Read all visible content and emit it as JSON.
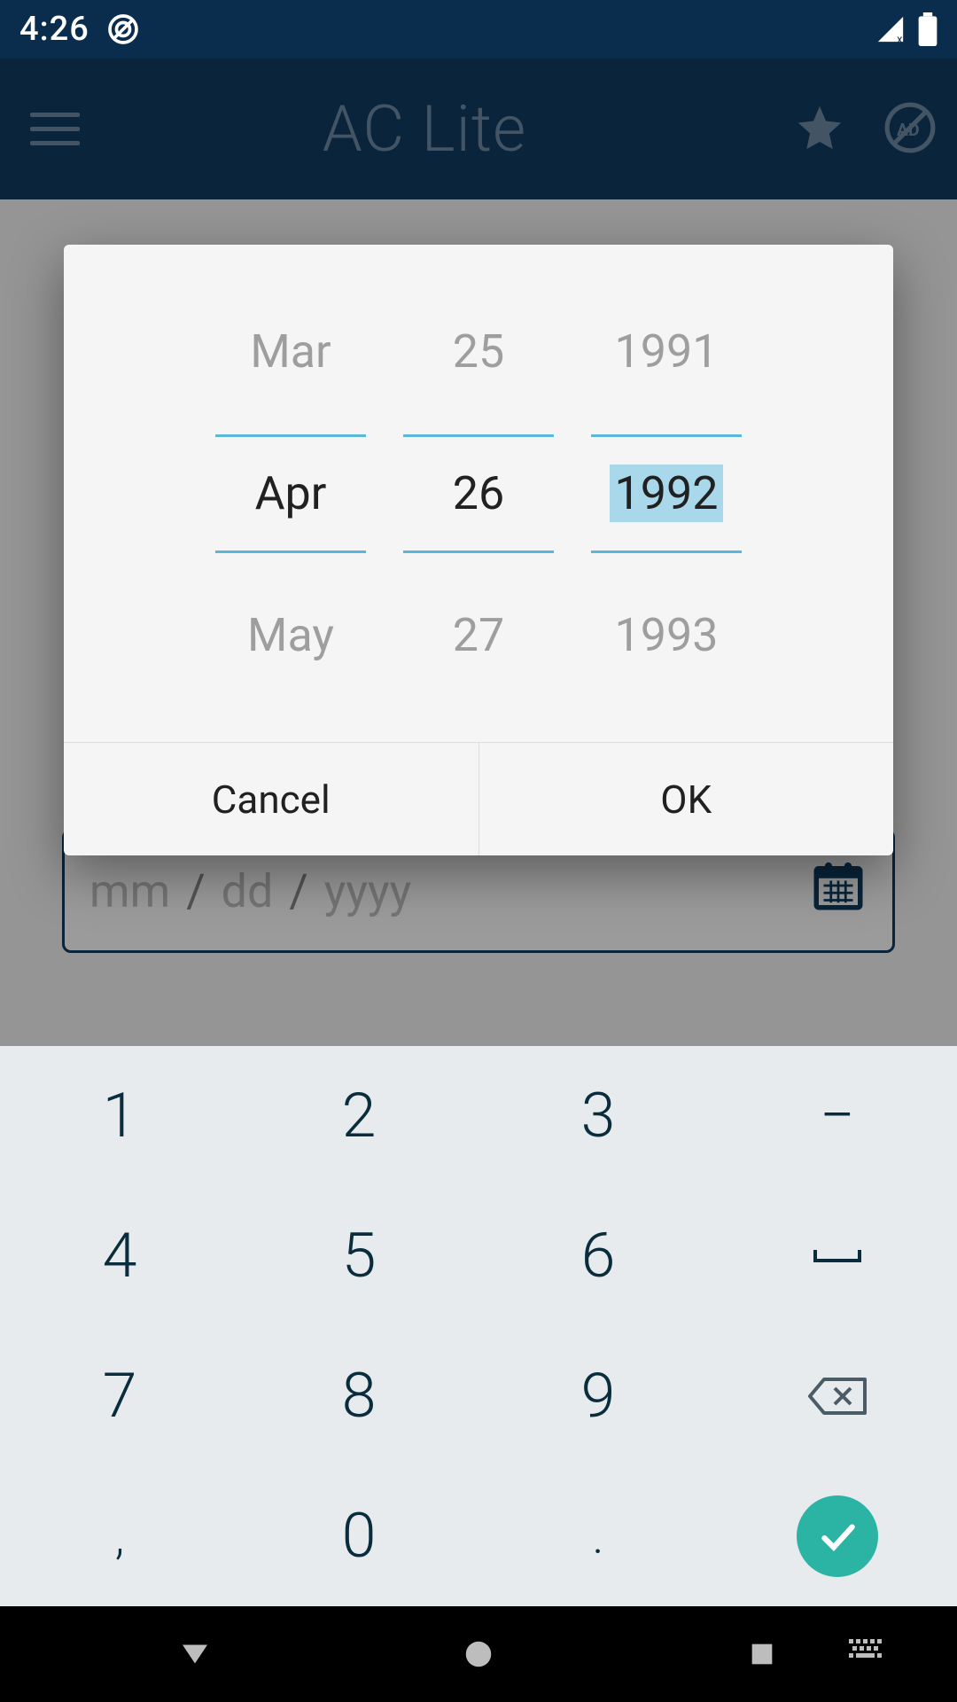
{
  "status": {
    "time": "4:26"
  },
  "appbar": {
    "title": "AC Lite"
  },
  "date_input": {
    "mm": "mm",
    "dd": "dd",
    "yyyy": "yyyy"
  },
  "picker": {
    "month": {
      "prev": "Mar",
      "sel": "Apr",
      "next": "May"
    },
    "day": {
      "prev": "25",
      "sel": "26",
      "next": "27"
    },
    "year": {
      "prev": "1991",
      "sel": "1992",
      "next": "1993"
    },
    "cancel": "Cancel",
    "ok": "OK"
  },
  "keyboard": {
    "k1": "1",
    "k2": "2",
    "k3": "3",
    "dash": "−",
    "k4": "4",
    "k5": "5",
    "k6": "6",
    "k7": "7",
    "k8": "8",
    "k9": "9",
    "comma": ",",
    "k0": "0",
    "dot": "."
  }
}
